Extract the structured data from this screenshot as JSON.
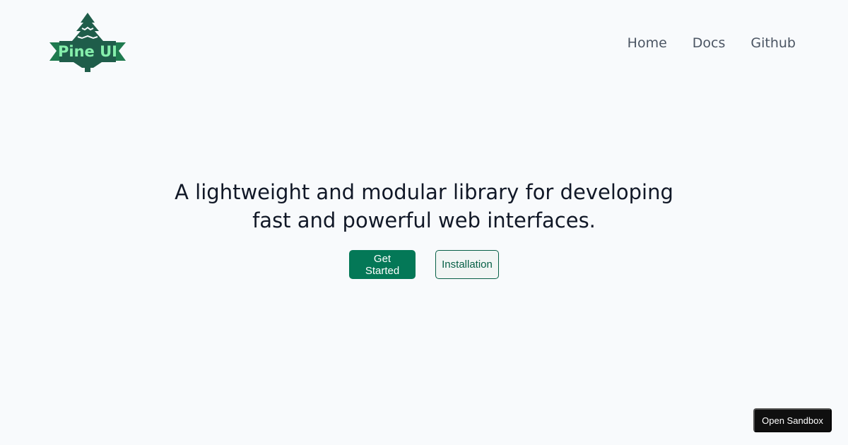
{
  "brand": {
    "name": "Pine UI",
    "logo_icon": "pine-tree-icon",
    "colors": {
      "tree": "#1f5d4a",
      "banner": "#1f7a4f",
      "text": "#86efac"
    }
  },
  "nav": {
    "items": [
      {
        "label": "Home"
      },
      {
        "label": "Docs"
      },
      {
        "label": "Github"
      }
    ]
  },
  "hero": {
    "headline": "A lightweight and modular library for developing fast and powerful web interfaces.",
    "primary_label": "Get Started",
    "secondary_label": "Installation"
  },
  "sandbox": {
    "label": "Open Sandbox"
  },
  "colors": {
    "background": "#f8fafc",
    "accent": "#047857",
    "accent_dark": "#065f46",
    "sandbox_bg": "#0f0f0f"
  }
}
